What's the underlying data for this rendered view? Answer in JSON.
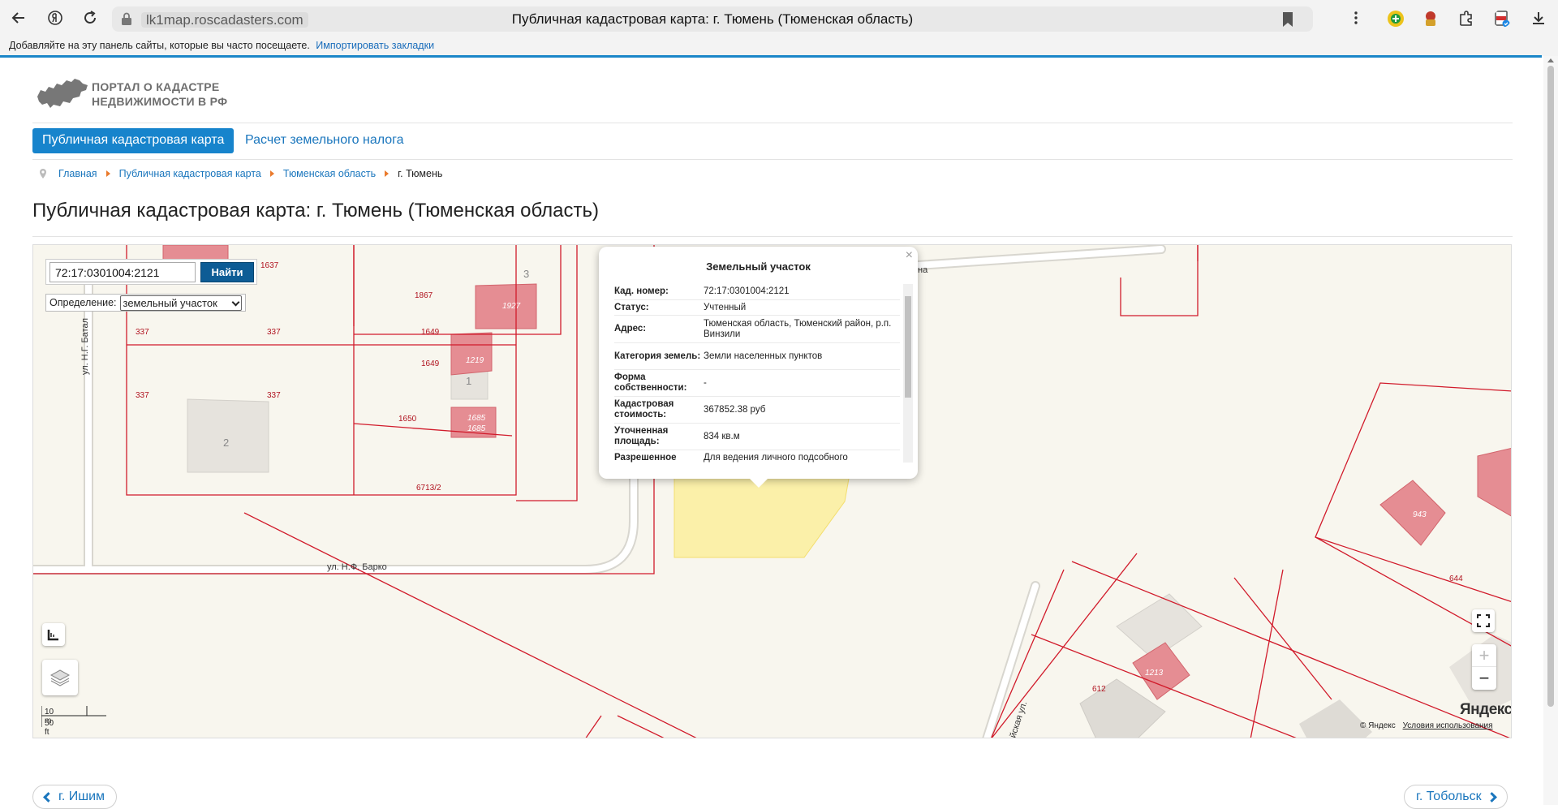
{
  "browser": {
    "domain": "lk1map.roscadasters.com",
    "tab_title": "Публичная кадастровая карта: г. Тюмень (Тюменская область)",
    "bookmarks_bar_text": "Добавляйте на эту панель сайты, которые вы часто посещаете.",
    "bookmarks_bar_link": "Импортировать закладки"
  },
  "site": {
    "logo_line1": "ПОРТАЛ О КАДАСТРЕ",
    "logo_line2": "НЕДВИЖИМОСТИ В РФ"
  },
  "menu": {
    "active": "Публичная кадастровая карта",
    "item2": "Расчет земельного налога"
  },
  "breadcrumb": {
    "home": "Главная",
    "map": "Публичная кадастровая карта",
    "region": "Тюменская область",
    "city": "г. Тюмень"
  },
  "page_title": "Публичная кадастровая карта: г. Тюмень (Тюменская область)",
  "map": {
    "search_value": "72:17:0301004:2121",
    "search_button": "Найти",
    "definition_label": "Определение:",
    "definition_value": "земельный участок",
    "scale_m": "10 m",
    "scale_ft": "50 ft",
    "yandex_logo": "Яндекс",
    "copyright": "© Яндекс",
    "terms": "Условия использования",
    "zoom_in": "+",
    "zoom_out": "−",
    "labels": {
      "street_barko": "ул. Н.Ф. Барко",
      "street_batalova": "ул. Н.Г. Батал",
      "street_diag": "йская ул.",
      "street_top": "на",
      "p1637": "1637",
      "p1867": "1867",
      "p1927": "1927",
      "p337a": "337",
      "p337b": "337",
      "p337c": "337",
      "p337d": "337",
      "p1649a": "1649",
      "p1649b": "1649",
      "p1219": "1219",
      "p1650": "1650",
      "p1685a": "1685",
      "p1685b": "1685",
      "p6713": "6713/2",
      "p943": "943",
      "p644": "644",
      "p612": "612",
      "p1213": "1213",
      "b1": "1",
      "b2": "2",
      "b3": "3"
    }
  },
  "popup": {
    "title": "Земельный участок",
    "close": "×",
    "rows": [
      {
        "k": "Кад. номер:",
        "v": "72:17:0301004:2121"
      },
      {
        "k": "Статус:",
        "v": "Учтенный"
      },
      {
        "k": "Адрес:",
        "v": "Тюменская область, Тюменский район, р.п. Винзили"
      },
      {
        "k": "Категория земель:",
        "v": "Земли населенных пунктов"
      },
      {
        "k": "Форма собственности:",
        "v": "-"
      },
      {
        "k": "Кадастровая стоимость:",
        "v": "367852.38 руб"
      },
      {
        "k": "Уточненная площадь:",
        "v": "834 кв.м"
      },
      {
        "k": "Разрешенное",
        "v": "Для ведения личного подсобного"
      }
    ]
  },
  "pager": {
    "prev": "г. Ишим",
    "next": "г. Тобольск"
  }
}
